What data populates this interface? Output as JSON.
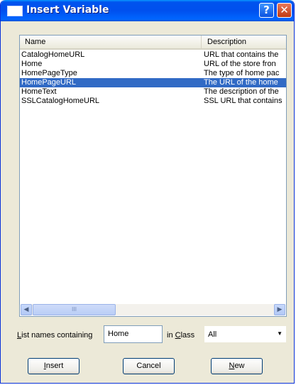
{
  "window": {
    "title": "Insert Variable",
    "help": "?",
    "close": "✕"
  },
  "list": {
    "columns": {
      "name": "Name",
      "description": "Description"
    },
    "rows": [
      {
        "name": "CatalogHomeURL",
        "description": "URL that contains the",
        "selected": false
      },
      {
        "name": "Home",
        "description": "URL of the store fron",
        "selected": false
      },
      {
        "name": "HomePageType",
        "description": "The type of home pac",
        "selected": false
      },
      {
        "name": "HomePageURL",
        "description": "The URL of the home",
        "selected": true
      },
      {
        "name": "HomeText",
        "description": "The description of the",
        "selected": false
      },
      {
        "name": "SSLCatalogHomeURL",
        "description": "SSL URL that contains",
        "selected": false
      }
    ],
    "scroll_thumb_grip": "III"
  },
  "filter": {
    "label_prefix": "L",
    "label_rest": "ist names containing",
    "value": "Home",
    "class_label_prefix": "in ",
    "class_label_accel": "C",
    "class_label_rest": "lass",
    "class_value": "All"
  },
  "buttons": {
    "insert_accel": "I",
    "insert_rest": "nsert",
    "cancel": "Cancel",
    "new_accel": "N",
    "new_rest": "ew"
  },
  "colors": {
    "selection": "#316ac5",
    "titlebar": "#0053ee",
    "dialog_bg": "#ece9d8"
  }
}
